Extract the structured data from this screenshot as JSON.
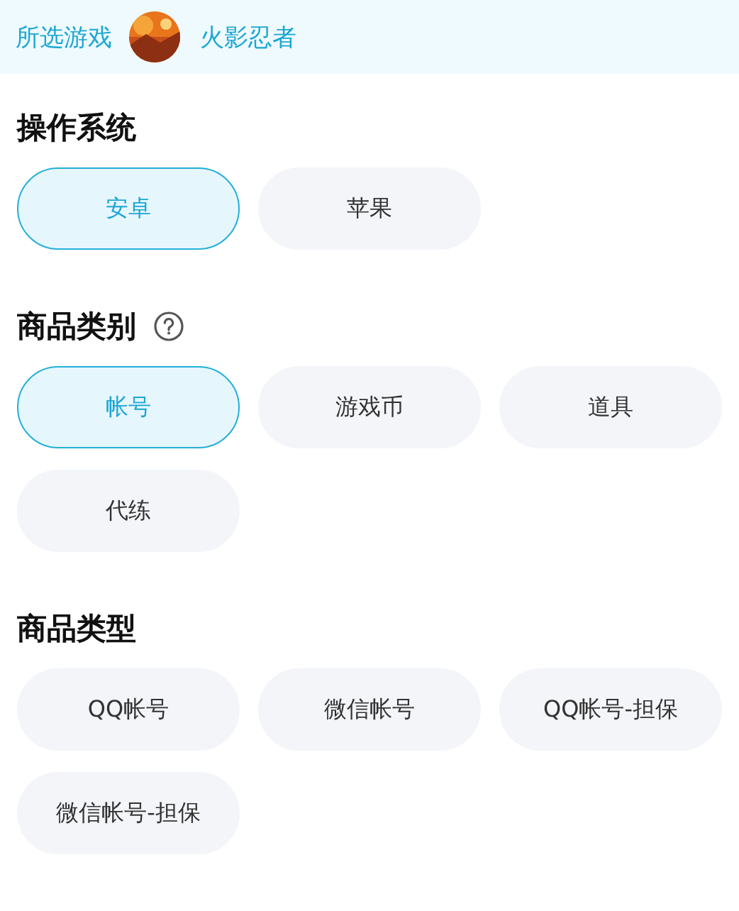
{
  "top_bar": {
    "label": "所选游戏",
    "game_name": "火影忍者"
  },
  "sections": [
    {
      "title": "操作系统",
      "help": false,
      "options": [
        {
          "label": "安卓",
          "selected": true
        },
        {
          "label": "苹果",
          "selected": false
        }
      ]
    },
    {
      "title": "商品类别",
      "help": true,
      "options": [
        {
          "label": "帐号",
          "selected": true
        },
        {
          "label": "游戏币",
          "selected": false
        },
        {
          "label": "道具",
          "selected": false
        },
        {
          "label": "代练",
          "selected": false
        }
      ]
    },
    {
      "title": "商品类型",
      "help": false,
      "options": [
        {
          "label": "QQ帐号",
          "selected": false
        },
        {
          "label": "微信帐号",
          "selected": false
        },
        {
          "label": "QQ帐号-担保",
          "selected": false
        },
        {
          "label": "微信帐号-担保",
          "selected": false
        }
      ]
    }
  ]
}
